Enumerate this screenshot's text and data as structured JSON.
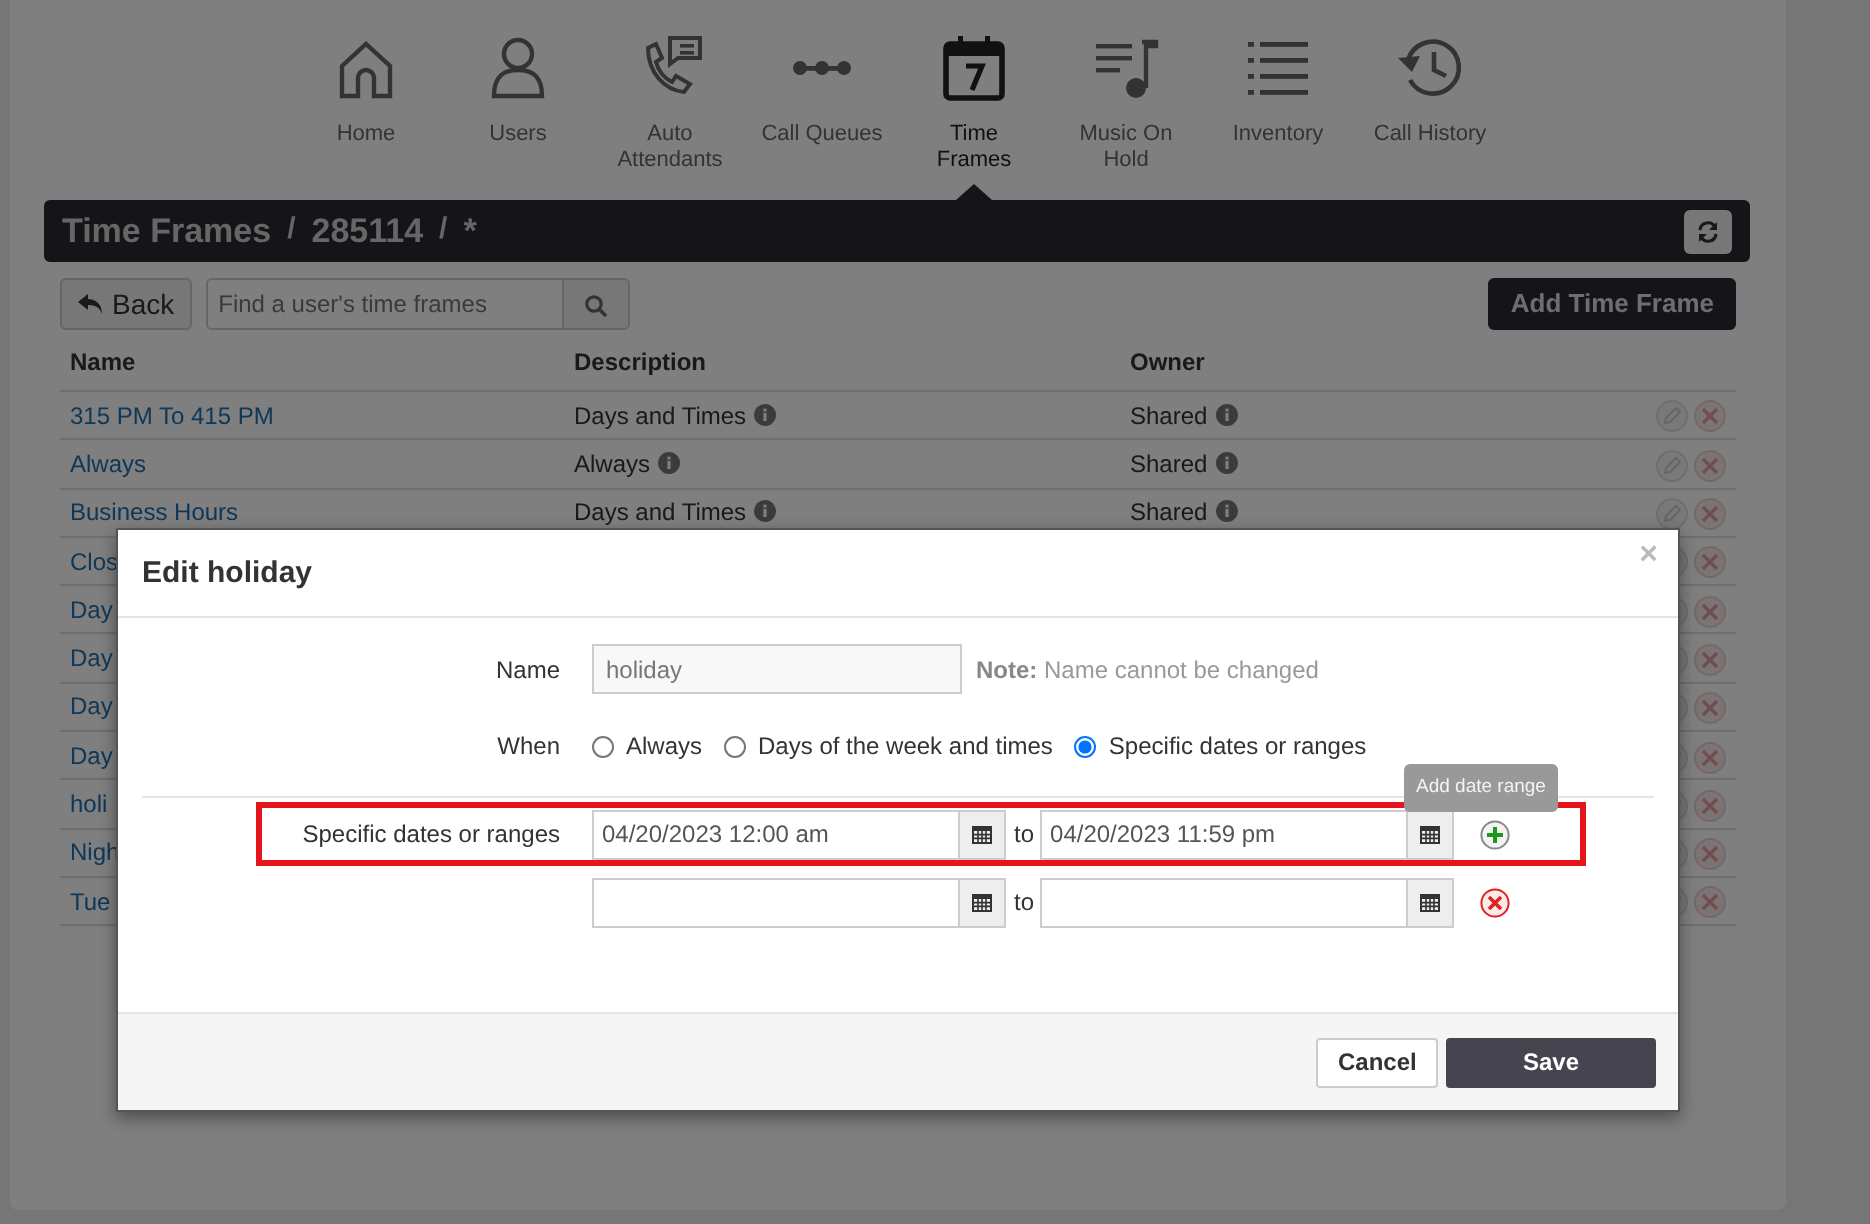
{
  "nav": [
    {
      "label": "Home",
      "selected": false
    },
    {
      "label": "Users",
      "selected": false
    },
    {
      "label": "Auto Attendants",
      "selected": false
    },
    {
      "label": "Call Queues",
      "selected": false
    },
    {
      "label": "Time Frames",
      "selected": true
    },
    {
      "label": "Music On Hold",
      "selected": false
    },
    {
      "label": "Inventory",
      "selected": false
    },
    {
      "label": "Call History",
      "selected": false
    }
  ],
  "breadcrumb": [
    "Time Frames",
    "/",
    "285114",
    "/",
    "*"
  ],
  "back_button": "Back",
  "search": {
    "placeholder": "Find a user's time frames"
  },
  "add_button": "Add Time Frame",
  "table": {
    "columns": [
      "Name",
      "Description",
      "Owner"
    ],
    "rows": [
      {
        "name": "315 PM To 415 PM",
        "description": "Days and Times",
        "owner": "Shared"
      },
      {
        "name": "Always",
        "description": "Always",
        "owner": "Shared"
      },
      {
        "name": "Business Hours",
        "description": "Days and Times",
        "owner": "Shared"
      },
      {
        "name": "Clos"
      },
      {
        "name": "Day"
      },
      {
        "name": "Day"
      },
      {
        "name": "Day"
      },
      {
        "name": "Day"
      },
      {
        "name": "holi"
      },
      {
        "name": "Nigh"
      },
      {
        "name": "Tue"
      }
    ]
  },
  "modal": {
    "title": "Edit holiday",
    "close": "×",
    "name_label": "Name",
    "name_value": "holiday",
    "note": "**Note:** Name cannot be changed",
    "when_label": "When",
    "when_options": [
      {
        "label": "Always",
        "selected": false
      },
      {
        "label": "Days of the week and times",
        "selected": false
      },
      {
        "label": "Specific dates or ranges",
        "selected": true
      }
    ],
    "ranges_label": "Specific dates or ranges",
    "ranges": [
      {
        "from": "04/20/2023 12:00 am",
        "to_label": "to",
        "to": "04/20/2023 11:59 pm",
        "kind": "add",
        "highlighted": true
      },
      {
        "to_label": "to",
        "kind": "remove",
        "highlighted": false
      }
    ],
    "tooltip": "Add date range",
    "buttons": [
      {
        "label": "Cancel",
        "kind": "default"
      },
      {
        "label": "Save",
        "kind": "primary"
      }
    ]
  }
}
